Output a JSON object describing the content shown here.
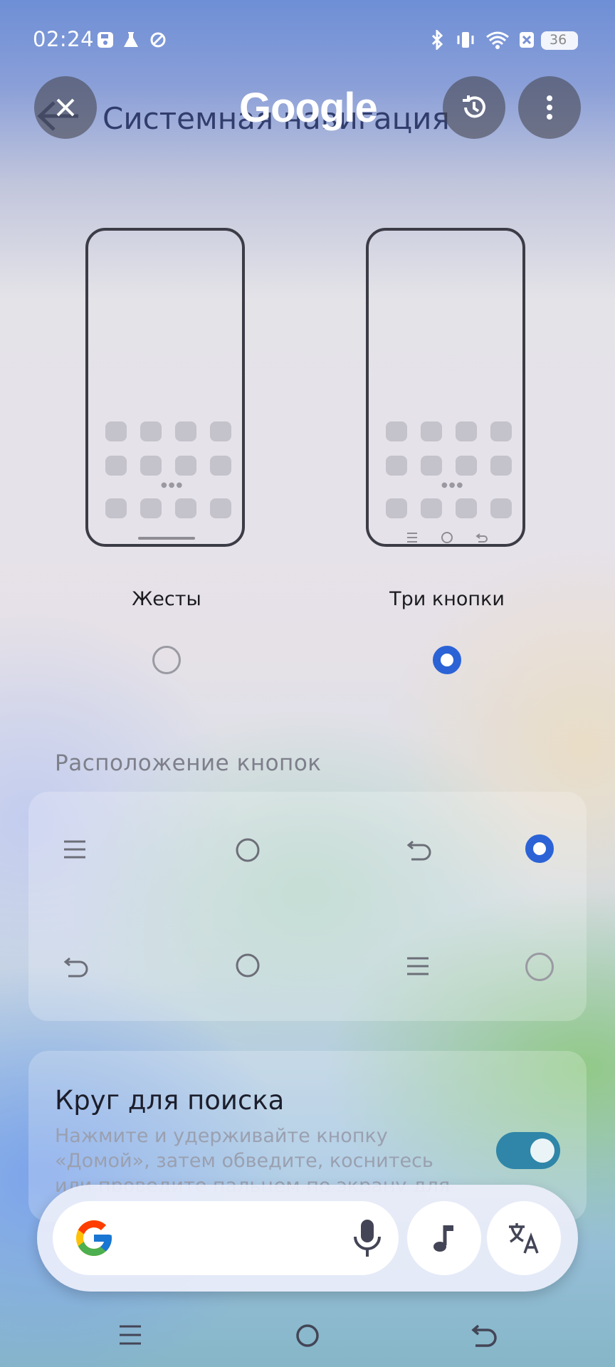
{
  "status_bar": {
    "time": "02:24",
    "battery": "36"
  },
  "header": {
    "brand": "Google",
    "page_title": "Системная навигация"
  },
  "nav_modes": {
    "options": [
      {
        "label": "Жесты",
        "selected": false
      },
      {
        "label": "Три кнопки",
        "selected": true
      }
    ]
  },
  "button_layout": {
    "section_label": "Расположение кнопок",
    "rows": [
      {
        "order": [
          "menu",
          "home",
          "back"
        ],
        "selected": true
      },
      {
        "order": [
          "back",
          "home",
          "menu"
        ],
        "selected": false
      }
    ]
  },
  "circle_to_search": {
    "title": "Круг для поиска",
    "description": "Нажмите и удерживайте кнопку «Домой», затем обведите, коснитесь или проведите пальцем по экрану для",
    "enabled": true
  },
  "colors": {
    "accent": "#2b63d6",
    "toggle_on": "#2f86a8"
  },
  "icons": {
    "close": "close-icon",
    "history": "history-icon",
    "more": "more-vert-icon",
    "mic": "mic-icon",
    "music": "music-note-icon",
    "translate": "translate-icon"
  }
}
